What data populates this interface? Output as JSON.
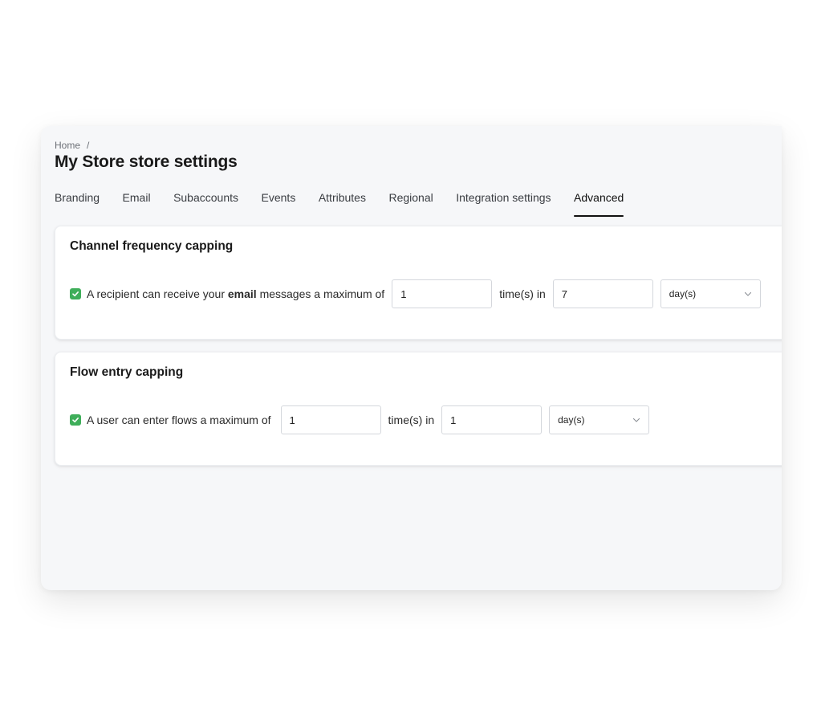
{
  "breadcrumb": {
    "home": "Home",
    "separator": "/"
  },
  "page_title": "My Store store settings",
  "tabs": [
    {
      "label": "Branding",
      "active": false
    },
    {
      "label": "Email",
      "active": false
    },
    {
      "label": "Subaccounts",
      "active": false
    },
    {
      "label": "Events",
      "active": false
    },
    {
      "label": "Attributes",
      "active": false
    },
    {
      "label": "Regional",
      "active": false
    },
    {
      "label": "Integration settings",
      "active": false
    },
    {
      "label": "Advanced",
      "active": true
    }
  ],
  "channel_capping": {
    "title": "Channel frequency capping",
    "checked": true,
    "text_before": "A recipient can receive your ",
    "text_bold": "email",
    "text_after": " messages a maximum of",
    "times_value": "1",
    "times_label": "time(s) in",
    "period_value": "7",
    "unit_selected": "day(s)"
  },
  "flow_capping": {
    "title": "Flow entry capping",
    "checked": true,
    "text": "A user can enter flows a maximum of",
    "times_value": "1",
    "times_label": "time(s) in",
    "period_value": "1",
    "unit_selected": "day(s)"
  },
  "colors": {
    "checkbox": "#3fae5a",
    "background": "#f6f7f9",
    "card": "#ffffff"
  },
  "icons": {
    "checkbox": "check-icon",
    "dropdown": "chevron-down-icon"
  }
}
